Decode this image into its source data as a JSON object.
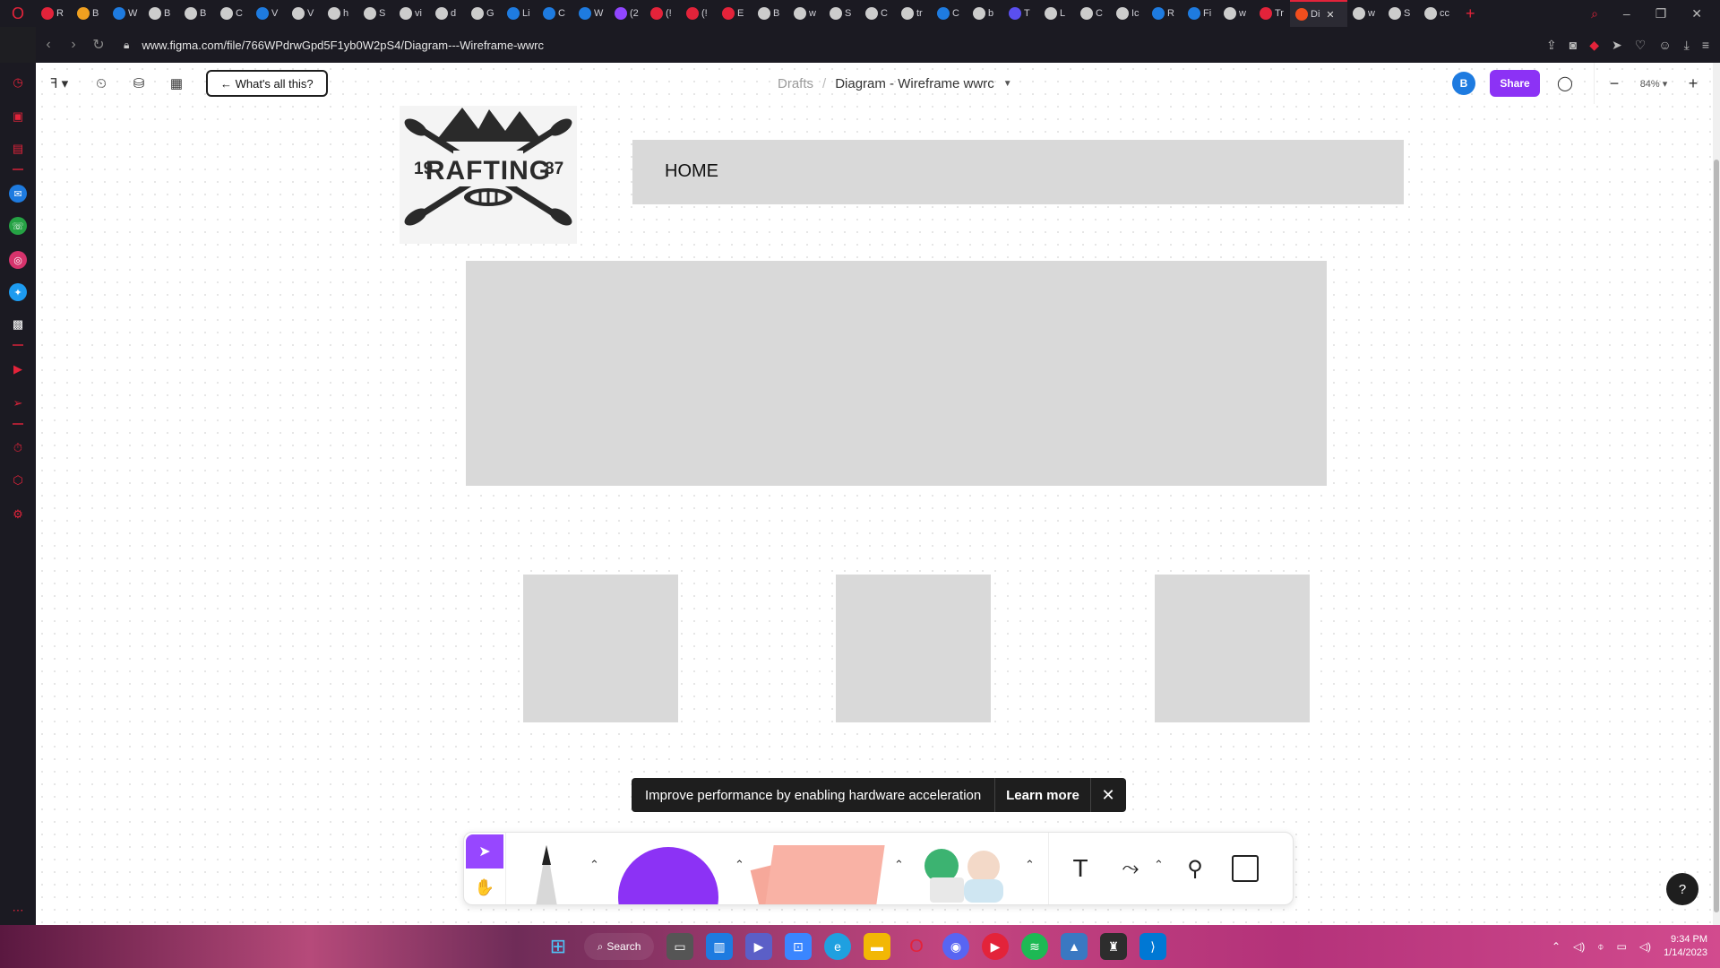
{
  "browser": {
    "tabs": [
      {
        "label": "R",
        "color": "#e3233a"
      },
      {
        "label": "B",
        "color": "#f0a020"
      },
      {
        "label": "W",
        "color": "#1e7be0"
      },
      {
        "label": "B",
        "color": "#cccccc"
      },
      {
        "label": "B",
        "color": "#cccccc"
      },
      {
        "label": "C",
        "color": "#cccccc"
      },
      {
        "label": "V",
        "color": "#1e7be0"
      },
      {
        "label": "V",
        "color": "#cccccc"
      },
      {
        "label": "h",
        "color": "#cccccc"
      },
      {
        "label": "S",
        "color": "#cccccc"
      },
      {
        "label": "vi",
        "color": "#cccccc"
      },
      {
        "label": "d",
        "color": "#cccccc"
      },
      {
        "label": "G",
        "color": "#cccccc"
      },
      {
        "label": "Li",
        "color": "#1e7be0"
      },
      {
        "label": "C",
        "color": "#1e7be0"
      },
      {
        "label": "W",
        "color": "#1e7be0"
      },
      {
        "label": "(2",
        "color": "#9146ff"
      },
      {
        "label": "(!",
        "color": "#e3233a"
      },
      {
        "label": "(!",
        "color": "#e3233a"
      },
      {
        "label": "E",
        "color": "#e3233a"
      },
      {
        "label": "B",
        "color": "#cccccc"
      },
      {
        "label": "w",
        "color": "#cccccc"
      },
      {
        "label": "S",
        "color": "#cccccc"
      },
      {
        "label": "C",
        "color": "#cccccc"
      },
      {
        "label": "tr",
        "color": "#cccccc"
      },
      {
        "label": "C",
        "color": "#1e7be0"
      },
      {
        "label": "b",
        "color": "#cccccc"
      },
      {
        "label": "T",
        "color": "#5a4ff0"
      },
      {
        "label": "L",
        "color": "#cccccc"
      },
      {
        "label": "C",
        "color": "#cccccc"
      },
      {
        "label": "Ic",
        "color": "#cccccc"
      },
      {
        "label": "R",
        "color": "#1e7be0"
      },
      {
        "label": "Fi",
        "color": "#1e7be0"
      },
      {
        "label": "w",
        "color": "#cccccc"
      },
      {
        "label": "Tr",
        "color": "#e3233a"
      }
    ],
    "active_tab": {
      "label": "Di",
      "color": "#f24e1e"
    },
    "tabs_after": [
      {
        "label": "w",
        "color": "#cccccc"
      },
      {
        "label": "S",
        "color": "#cccccc"
      },
      {
        "label": "cc",
        "color": "#cccccc"
      }
    ],
    "url": "www.figma.com/file/766WPdrwGpd5F1yb0W2pS4/Diagram---Wireframe-wwrc"
  },
  "figma": {
    "whats_label": "← What's all this?",
    "breadcrumb_drafts": "Drafts",
    "breadcrumb_sep": "/",
    "file_name": "Diagram - Wireframe wwrc",
    "avatar_initial": "B",
    "share_label": "Share",
    "zoom_level": "84%"
  },
  "canvas": {
    "logo": {
      "left_num": "19",
      "title": "RAFTING",
      "right_num": "87"
    },
    "header_label": "HOME"
  },
  "toast": {
    "message": "Improve performance by enabling hardware acceleration",
    "learn_more": "Learn more"
  },
  "help_label": "?",
  "taskbar": {
    "search_label": "Search",
    "time": "9:34 PM",
    "date": "1/14/2023"
  }
}
